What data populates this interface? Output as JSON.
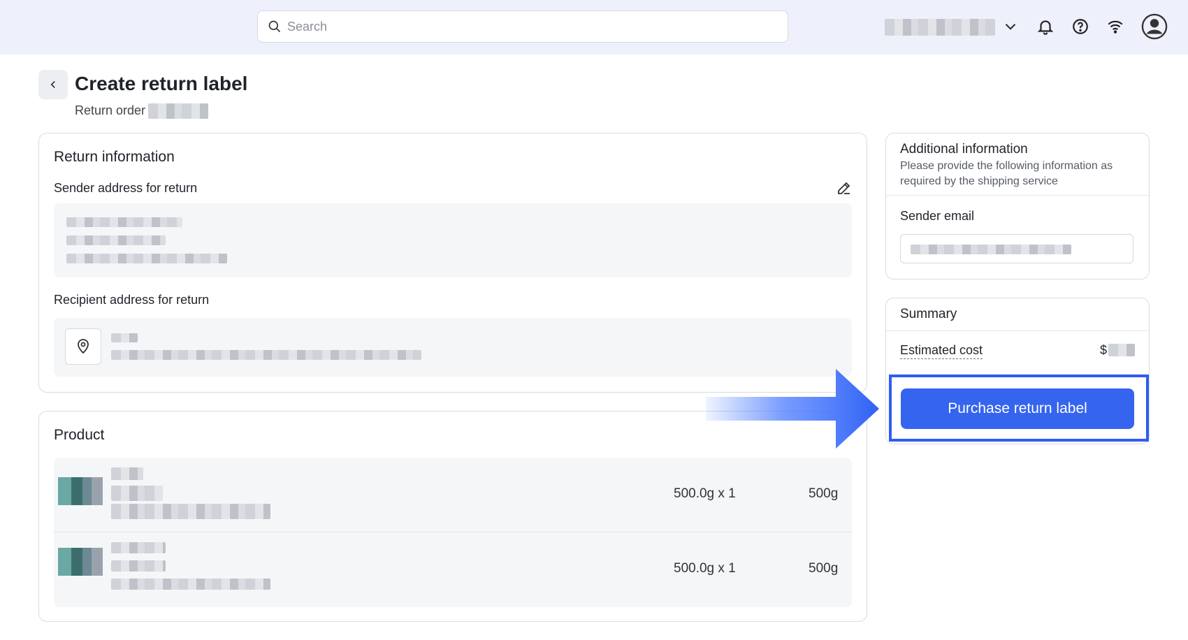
{
  "topbar": {
    "search_placeholder": "Search",
    "icons": [
      "search-icon",
      "chevron-down-icon",
      "bell-icon",
      "help-icon",
      "wifi-icon",
      "user-avatar-icon"
    ]
  },
  "page": {
    "title": "Create return label",
    "subtitle": "Return order"
  },
  "return_info": {
    "title": "Return information",
    "sender_label": "Sender address for return",
    "recipient_label": "Recipient address for return"
  },
  "product": {
    "title": "Product",
    "rows": [
      {
        "qty": "500.0g x 1",
        "weight": "500g"
      },
      {
        "qty": "500.0g x 1",
        "weight": "500g"
      }
    ]
  },
  "additional": {
    "title": "Additional information",
    "desc": "Please provide the following information as required by the shipping service",
    "sender_email_label": "Sender email"
  },
  "summary": {
    "title": "Summary",
    "estimated_cost_label": "Estimated cost",
    "currency": "$",
    "purchase_label": "Purchase return label"
  },
  "colors": {
    "accent": "#3564ee",
    "highlight_frame": "#2f5cf2",
    "topbar_bg": "#eef1fb"
  }
}
